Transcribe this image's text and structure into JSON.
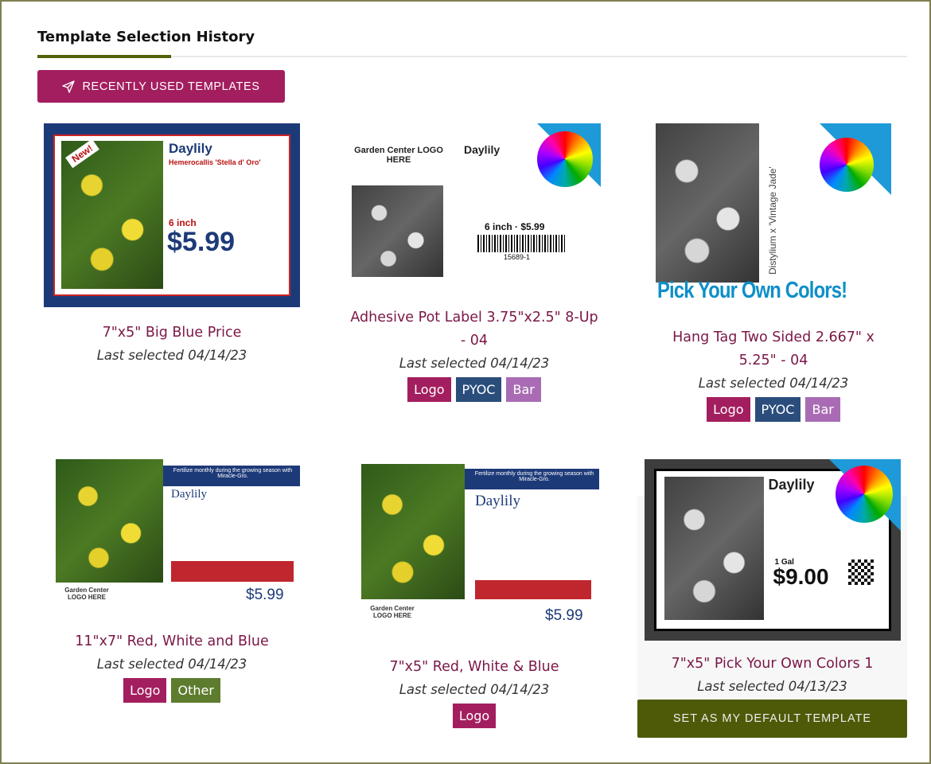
{
  "header": {
    "title": "Template Selection History",
    "recent_button": "RECENTLY USED TEMPLATES"
  },
  "colors": {
    "accent": "#a31e5f",
    "underline": "#556108",
    "title": "#7b1747",
    "logo": "#a31e5f",
    "pyoc": "#2b4d7c",
    "bar": "#a96cb4",
    "other": "#5d7c2e",
    "default_button": "#4e5a08"
  },
  "templates": [
    {
      "name": "7\"x5\" Big Blue Price",
      "date": "Last selected 04/14/23",
      "badges": [],
      "thumb": {
        "heading": "Daylily",
        "sub": "Hemerocallis 'Stella d' Oro'",
        "price": "$5.99",
        "size": "6 inch",
        "flag": "New!"
      }
    },
    {
      "name": "Adhesive Pot Label 3.75\"x2.5\" 8-Up - 04",
      "date": "Last selected 04/14/23",
      "badges": [
        "Logo",
        "PYOC",
        "Bar"
      ],
      "thumb": {
        "logo": "Garden Center LOGO HERE",
        "heading": "Daylily",
        "price": "6 inch · $5.99",
        "barcode": "15689-1"
      }
    },
    {
      "name": "Hang Tag Two Sided 2.667\" x 5.25\" - 04",
      "date": "Last selected 04/14/23",
      "badges": [
        "Logo",
        "PYOC",
        "Bar"
      ],
      "thumb": {
        "banner": "Pick Your Own Colors!",
        "side": "Distylium x 'Vintage Jade'"
      }
    },
    {
      "name": "11\"x7\" Red, White and Blue",
      "date": "Last selected 04/14/23",
      "badges": [
        "Logo",
        "Other"
      ],
      "thumb": {
        "banner": "Fertilize monthly during the growing season with Miracle-Gro.",
        "heading": "Daylily",
        "price": "$5.99",
        "logo": "Garden Center LOGO HERE"
      }
    },
    {
      "name": "7\"x5\" Red, White & Blue",
      "date": "Last selected 04/14/23",
      "badges": [
        "Logo"
      ],
      "thumb": {
        "banner": "Fertilize monthly during the growing season with Miracle-Gro.",
        "heading": "Daylily",
        "price": "$5.99",
        "logo": "Garden Center LOGO HERE"
      }
    },
    {
      "name": "7\"x5\" Pick Your Own Colors 1",
      "date": "Last selected 04/13/23",
      "badges": [],
      "thumb": {
        "heading": "Daylily",
        "price": "$9.00",
        "size": "1 Gal"
      }
    }
  ],
  "default_button": "SET AS MY DEFAULT TEMPLATE"
}
